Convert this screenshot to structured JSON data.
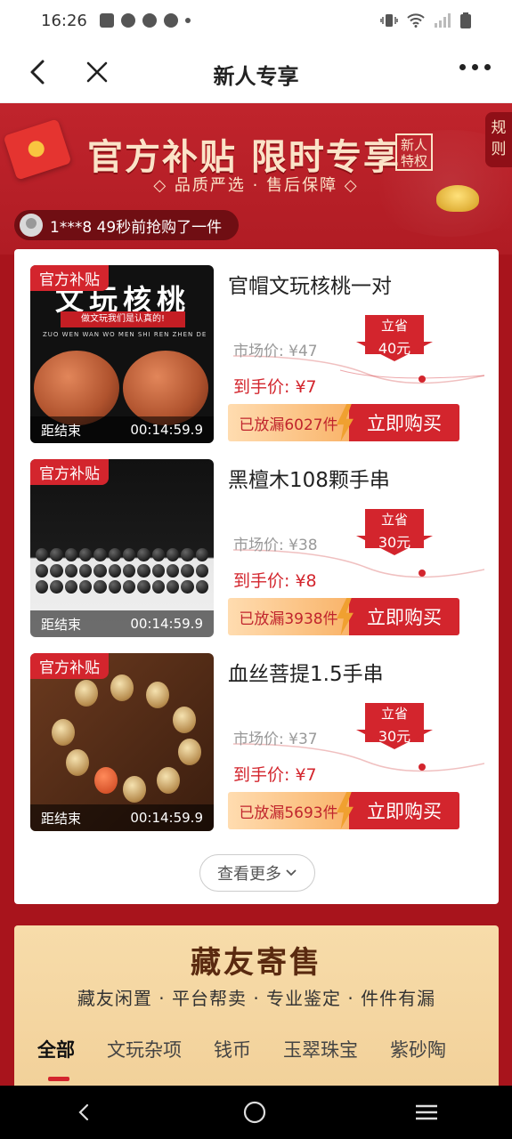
{
  "status_bar": {
    "time": "16:26"
  },
  "nav": {
    "title": "新人专享"
  },
  "banner": {
    "headline": "官方补贴 限时专享",
    "badge": "新人特权",
    "tagline": "◇ 品质严选 · 售后保障 ◇",
    "rules_tab": "规则"
  },
  "ticker": {
    "text": "1***8 49秒前抢购了一件"
  },
  "products": [
    {
      "tag": "官方补贴",
      "name": "官帽文玩核桃一对",
      "market_price": "市场价: ¥47",
      "deal_price": "到手价: ¥7",
      "save_label": "立省",
      "save_amount": "40元",
      "released": "已放漏6027件",
      "buy": "立即购买",
      "countdown_label": "距结束",
      "countdown": "00:14:59.9",
      "image_heading": "文玩核桃",
      "image_banner": "做文玩我们是认真的!",
      "image_pinyin": "ZUO WEN WAN WO MEN SHI REN ZHEN DE"
    },
    {
      "tag": "官方补贴",
      "name": "黑檀木108颗手串",
      "market_price": "市场价: ¥38",
      "deal_price": "到手价: ¥8",
      "save_label": "立省",
      "save_amount": "30元",
      "released": "已放漏3938件",
      "buy": "立即购买",
      "countdown_label": "距结束",
      "countdown": "00:14:59.9"
    },
    {
      "tag": "官方补贴",
      "name": "血丝菩提1.5手串",
      "market_price": "市场价: ¥37",
      "deal_price": "到手价: ¥7",
      "save_label": "立省",
      "save_amount": "30元",
      "released": "已放漏5693件",
      "buy": "立即购买",
      "countdown_label": "距结束",
      "countdown": "00:14:59.9"
    }
  ],
  "more_button": "查看更多",
  "collector": {
    "title": "藏友寄售",
    "subtitle": "藏友闲置 · 平台帮卖 · 专业鉴定 · 件件有漏",
    "categories": [
      "全部",
      "文玩杂项",
      "钱币",
      "玉翠珠宝",
      "紫砂陶"
    ]
  },
  "colors": {
    "accent_red": "#d3252d",
    "banner_red": "#b01c24",
    "gold": "#f7dcaa"
  }
}
